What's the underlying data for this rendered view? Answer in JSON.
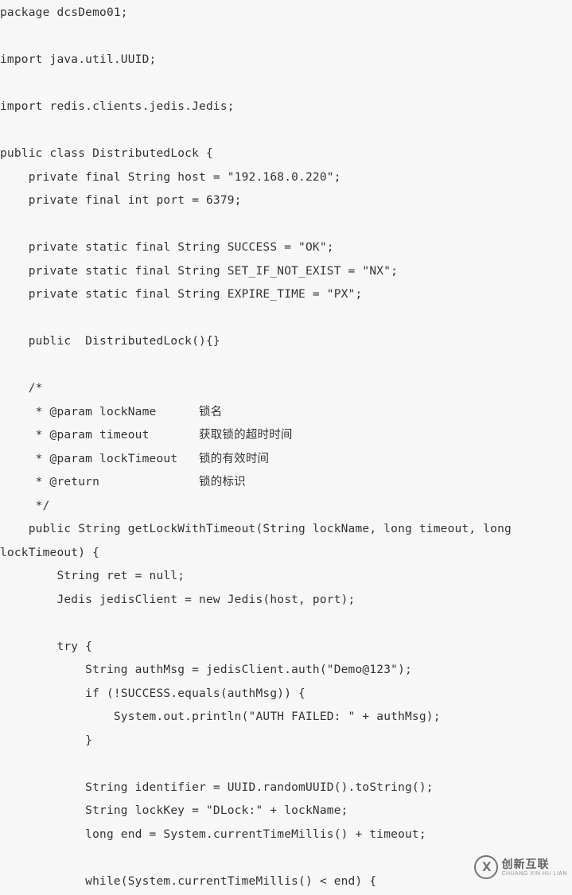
{
  "code_lines": [
    "package dcsDemo01;",
    "",
    "import java.util.UUID;",
    "",
    "import redis.clients.jedis.Jedis;",
    "",
    "public class DistributedLock {",
    "    private final String host = \"192.168.0.220\";",
    "    private final int port = 6379;",
    "",
    "    private static final String SUCCESS = \"OK\";",
    "    private static final String SET_IF_NOT_EXIST = \"NX\";",
    "    private static final String EXPIRE_TIME = \"PX\";",
    "",
    "    public  DistributedLock(){}",
    "",
    "    /*",
    "     * @param lockName      锁名",
    "     * @param timeout       获取锁的超时时间",
    "     * @param lockTimeout   锁的有效时间",
    "     * @return              锁的标识",
    "     */",
    "    public String getLockWithTimeout(String lockName, long timeout, long lockTimeout) {",
    "        String ret = null;",
    "        Jedis jedisClient = new Jedis(host, port);",
    "",
    "        try {",
    "            String authMsg = jedisClient.auth(\"Demo@123\");",
    "            if (!SUCCESS.equals(authMsg)) {",
    "                System.out.println(\"AUTH FAILED: \" + authMsg);",
    "            }",
    "",
    "            String identifier = UUID.randomUUID().toString();",
    "            String lockKey = \"DLock:\" + lockName;",
    "            long end = System.currentTimeMillis() + timeout;",
    "",
    "            while(System.currentTimeMillis() < end) {"
  ],
  "watermark": {
    "main": "创新互联",
    "sub": "CHUANG XIN HU LIAN"
  }
}
